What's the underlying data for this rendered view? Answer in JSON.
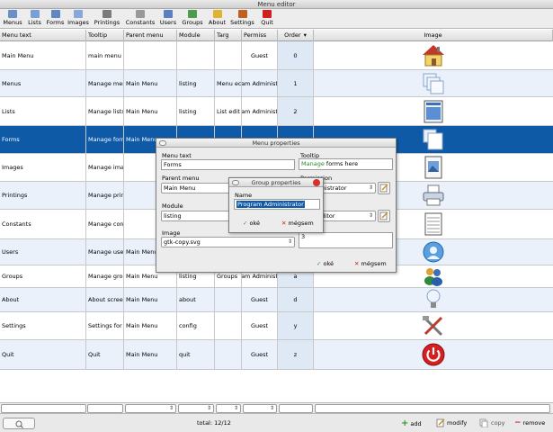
{
  "window": {
    "title": "Menu editor"
  },
  "toolbar": [
    {
      "label": "Menus",
      "icon": "menus-icon"
    },
    {
      "label": "Lists",
      "icon": "lists-icon"
    },
    {
      "label": "Forms",
      "icon": "forms-icon"
    },
    {
      "label": "Images",
      "icon": "images-icon"
    },
    {
      "label": "Printings",
      "icon": "printer-icon"
    },
    {
      "label": "Constants",
      "icon": "constants-icon"
    },
    {
      "label": "Users",
      "icon": "users-icon"
    },
    {
      "label": "Groups",
      "icon": "groups-icon"
    },
    {
      "label": "About",
      "icon": "about-icon"
    },
    {
      "label": "Settings",
      "icon": "settings-icon"
    },
    {
      "label": "Quit",
      "icon": "quit-icon"
    }
  ],
  "table": {
    "headers": [
      "Menu text",
      "Tooltip",
      "Parent menu",
      "Module",
      "Targ",
      "Permiss",
      "Order",
      "Image"
    ],
    "sort_indicator": "▾",
    "rows": [
      {
        "text": "Main Menu",
        "tooltip": "main menu",
        "parent": "",
        "module": "",
        "target": "",
        "perm": "Guest",
        "order": "0",
        "icon": "house-icon"
      },
      {
        "text": "Menus",
        "tooltip": "Manage mer",
        "parent": "Main Menu",
        "module": "listing",
        "target": "Menu ec",
        "perm": "am Administ",
        "order": "1",
        "icon": "menus-stack-icon"
      },
      {
        "text": "Lists",
        "tooltip": "Manage lists",
        "parent": "Main Menu",
        "module": "listing",
        "target": "List edit",
        "perm": "am Administ",
        "order": "2",
        "icon": "list-window-icon"
      },
      {
        "text": "Forms",
        "tooltip": "Manage forn",
        "parent": "Main Menu",
        "module": "",
        "target": "",
        "perm": "",
        "order": "",
        "icon": "forms-stack-icon"
      },
      {
        "text": "Images",
        "tooltip": "Manage imag",
        "parent": "",
        "module": "",
        "target": "",
        "perm": "",
        "order": "",
        "icon": "image-file-icon"
      },
      {
        "text": "Printings",
        "tooltip": "Manage prin",
        "parent": "",
        "module": "",
        "target": "",
        "perm": "",
        "order": "",
        "icon": "printer-icon"
      },
      {
        "text": "Constants",
        "tooltip": "Manage con",
        "parent": "",
        "module": "",
        "target": "",
        "perm": "",
        "order": "",
        "icon": "constants-sheet-icon"
      },
      {
        "text": "Users",
        "tooltip": "Manage use",
        "parent": "Main Menu",
        "module": "",
        "target": "",
        "perm": "",
        "order": "",
        "icon": "users-globe-icon"
      },
      {
        "text": "Groups",
        "tooltip": "Manage grou",
        "parent": "Main Menu",
        "module": "listing",
        "target": "Groups",
        "perm": "am Administ",
        "order": "a",
        "icon": "groups-people-icon"
      },
      {
        "text": "About",
        "tooltip": "About scree",
        "parent": "Main Menu",
        "module": "about",
        "target": "",
        "perm": "Guest",
        "order": "d",
        "icon": "lightbulb-icon"
      },
      {
        "text": "Settings",
        "tooltip": "Settings for",
        "parent": "Main Menu",
        "module": "config",
        "target": "",
        "perm": "Guest",
        "order": "y",
        "icon": "tools-icon"
      },
      {
        "text": "Quit",
        "tooltip": "Quit",
        "parent": "Main Menu",
        "module": "quit",
        "target": "",
        "perm": "Guest",
        "order": "z",
        "icon": "power-icon"
      }
    ]
  },
  "status": {
    "total": "total: 12/12",
    "add": "add",
    "modify": "modify",
    "copy": "copy",
    "remove": "remove"
  },
  "menu_dialog": {
    "title": "Menu properties",
    "menu_text_label": "Menu text",
    "menu_text_value": "Forms",
    "tooltip_label": "Tooltip",
    "tooltip_value_a": "Manage",
    "tooltip_value_b": "forms here",
    "parent_label": "Parent menu",
    "parent_value": "Main Menu",
    "permission_label": "Permission",
    "permission_value": "n Administrator",
    "module_label": "Module",
    "module_value": "listing",
    "target_value": "Form editor",
    "image_label": "Image",
    "image_value": "gtk-copy.svg",
    "order_value": "3",
    "ok": "oké",
    "cancel": "mégsem"
  },
  "group_dialog": {
    "title": "Group properties",
    "name_label": "Name",
    "name_value": "Program Administrator",
    "ok": "oké",
    "cancel": "mégsem"
  },
  "colors": {
    "selection": "#0e5aa7",
    "alt_row": "#eaf1fb",
    "add_green": "#2a9a2a",
    "remove_red": "#cc2222"
  }
}
